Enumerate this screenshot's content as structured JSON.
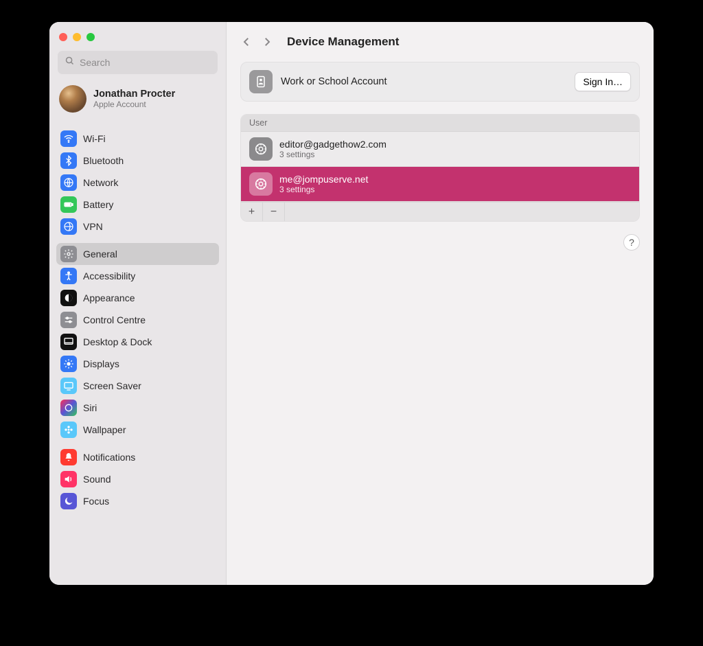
{
  "search": {
    "placeholder": "Search"
  },
  "account": {
    "name": "Jonathan Procter",
    "sub": "Apple Account"
  },
  "sidebar": {
    "group1": [
      {
        "label": "Wi-Fi"
      },
      {
        "label": "Bluetooth"
      },
      {
        "label": "Network"
      },
      {
        "label": "Battery"
      },
      {
        "label": "VPN"
      }
    ],
    "group2": [
      {
        "label": "General"
      },
      {
        "label": "Accessibility"
      },
      {
        "label": "Appearance"
      },
      {
        "label": "Control Centre"
      },
      {
        "label": "Desktop & Dock"
      },
      {
        "label": "Displays"
      },
      {
        "label": "Screen Saver"
      },
      {
        "label": "Siri"
      },
      {
        "label": "Wallpaper"
      }
    ],
    "group3": [
      {
        "label": "Notifications"
      },
      {
        "label": "Sound"
      },
      {
        "label": "Focus"
      }
    ]
  },
  "header": {
    "title": "Device Management"
  },
  "work_card": {
    "label": "Work or School Account",
    "button": "Sign In…"
  },
  "user_section": {
    "heading": "User",
    "rows": [
      {
        "primary": "editor@gadgethow2.com",
        "sub": "3 settings",
        "selected": false
      },
      {
        "primary": "me@jompuserve.net",
        "sub": "3 settings",
        "selected": true
      }
    ]
  },
  "help": {
    "label": "?"
  }
}
